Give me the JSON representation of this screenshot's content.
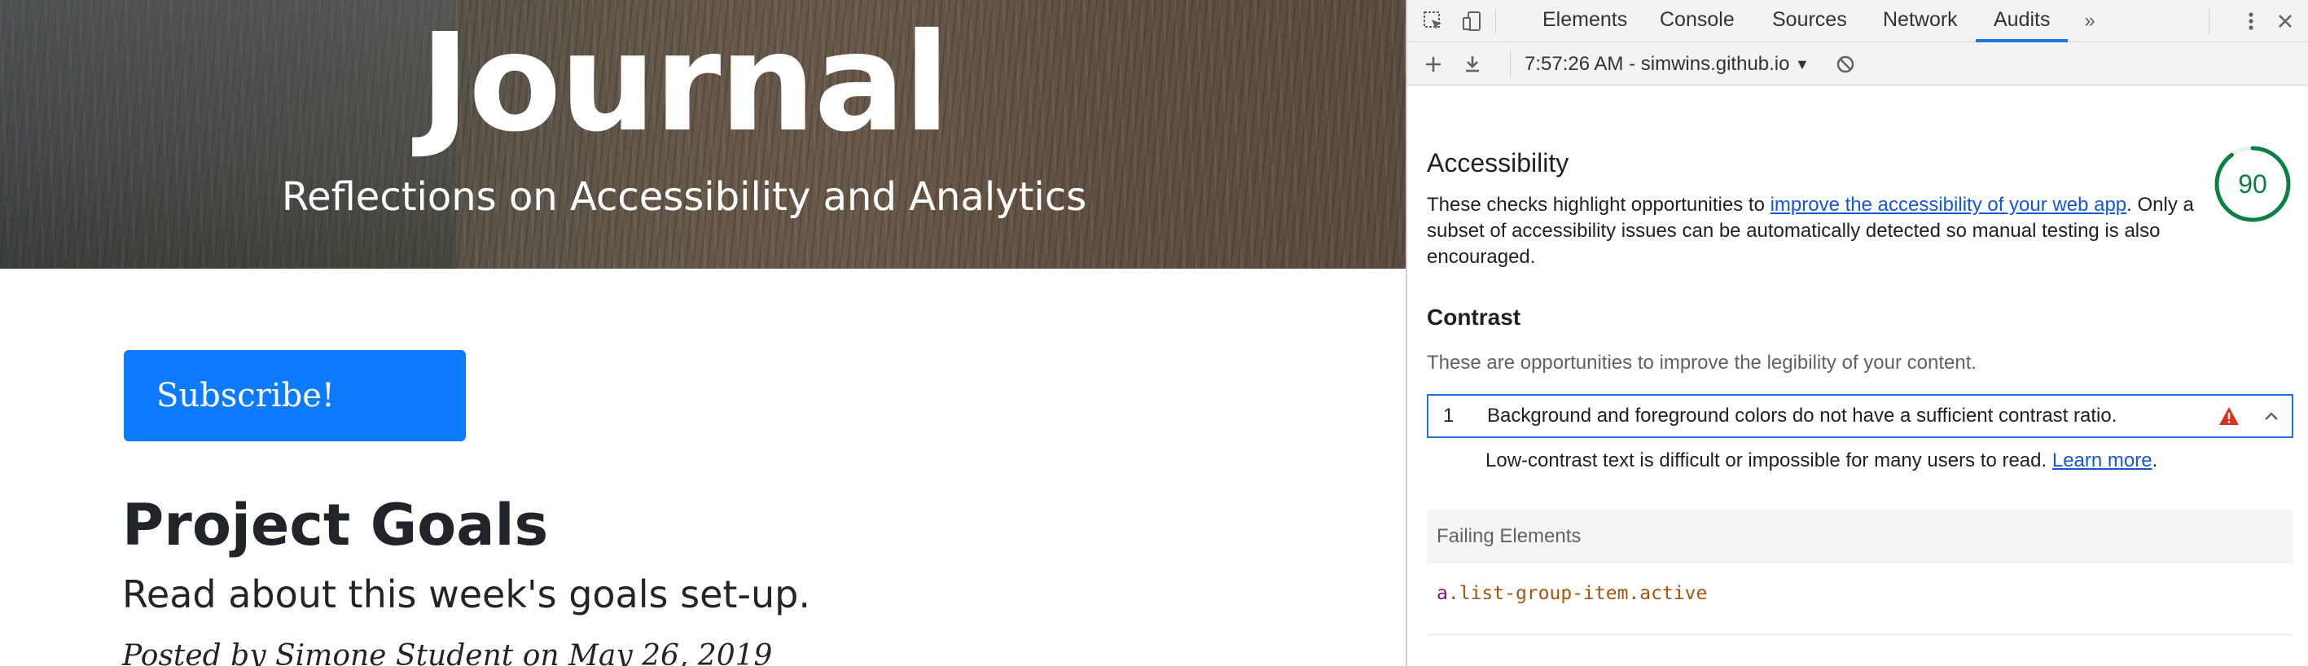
{
  "page": {
    "hero": {
      "title": "Journal",
      "subtitle": "Reflections on Accessibility and Analytics"
    },
    "subscribe_label": "Subscribe!",
    "post": {
      "title": "Project Goals",
      "subtitle": "Read about this week's goals set-up.",
      "meta_prefix": "Posted by ",
      "author": "Simone Student",
      "meta_suffix": " on May 26, 2019"
    }
  },
  "devtools": {
    "tabs": [
      "Elements",
      "Console",
      "Sources",
      "Network",
      "Audits"
    ],
    "active_tab": "Audits",
    "more_tabs_icon": "double-chevron-icon",
    "toolbar": {
      "report_label": "7:57:26 AM - simwins.github.io"
    },
    "accessibility": {
      "title": "Accessibility",
      "score": "90",
      "desc_before": "These checks highlight opportunities to ",
      "desc_link": "improve the accessibility of your web app",
      "desc_after": ". Only a subset of accessibility issues can be automatically detected so manual testing is also encouraged."
    },
    "contrast": {
      "title": "Contrast",
      "desc": "These are opportunities to improve the legibility of your content.",
      "audit": {
        "index": "1",
        "text": "Background and foreground colors do not have a sufficient contrast ratio."
      },
      "detail_text": "Low-contrast text is difficult or impossible for many users to read. ",
      "learn_more": "Learn more",
      "detail_end": ".",
      "failing_label": "Failing Elements",
      "failing_tag": "a",
      "failing_class": ".list-group-item.active"
    }
  },
  "colors": {
    "accent": "#1a73e8",
    "score_good": "#0b8043",
    "subscribe_bg": "#0d7bff",
    "warn": "#d93025"
  }
}
